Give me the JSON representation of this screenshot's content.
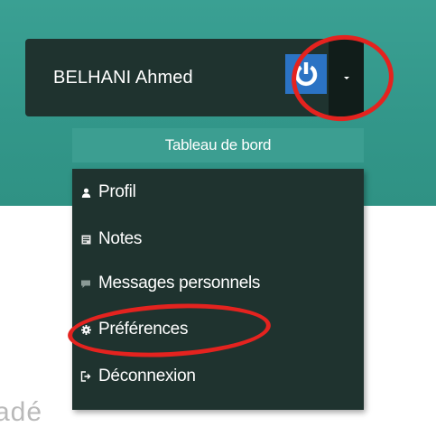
{
  "user_menu": {
    "user_name": "BELHANI Ahmed",
    "power_icon": "power-icon",
    "toggle_icon": "caret-down-icon"
  },
  "dashboard": {
    "label": "Tableau de bord"
  },
  "menu": {
    "items": [
      {
        "label": "Profil",
        "icon": "user-icon"
      },
      {
        "label": "Notes",
        "icon": "notes-icon"
      },
      {
        "label": "Messages personnels",
        "icon": "message-icon"
      },
      {
        "label": "Préférences",
        "icon": "gear-icon"
      },
      {
        "label": "Déconnexion",
        "icon": "logout-icon"
      }
    ]
  },
  "background": {
    "partial_text": "adé"
  },
  "colors": {
    "teal": "#33978a",
    "dark": "#1f332f",
    "power_blue": "#2b73c4",
    "annotation_red": "#e4231f"
  }
}
